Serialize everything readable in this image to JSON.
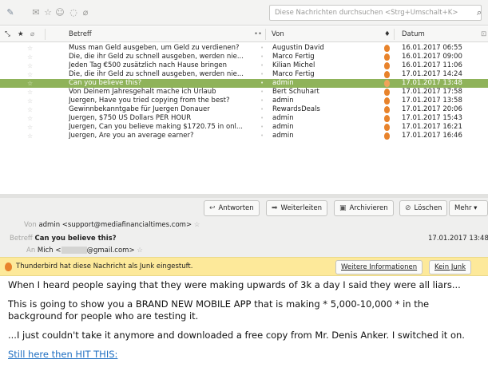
{
  "toolbar": {
    "icons": [
      "pin-icon",
      "unread-icon",
      "star-icon",
      "contact-icon",
      "tag-icon",
      "attachment-icon"
    ],
    "search_placeholder": "Diese Nachrichten durchsuchen <Strg+Umschalt+K>"
  },
  "list_header": {
    "subject": "Betreff",
    "from": "Von",
    "date": "Datum"
  },
  "messages": [
    {
      "subject": "Muss man Geld ausgeben, um Geld zu verdienen?",
      "from": "Augustin David",
      "date": "16.01.2017 06:55"
    },
    {
      "subject": "Die, die ihr Geld zu schnell ausgeben, werden nie...",
      "from": "Marco Fertig",
      "date": "16.01.2017 09:00"
    },
    {
      "subject": "Jeden Tag €500 zusätzlich nach Hause bringen",
      "from": "Kilian Michel",
      "date": "16.01.2017 11:06"
    },
    {
      "subject": "Die, die ihr Geld zu schnell ausgeben, werden nie...",
      "from": "Marco Fertig",
      "date": "17.01.2017 14:24"
    },
    {
      "subject": "Can you believe this?",
      "from": "admin",
      "date": "17.01.2017 13:48"
    },
    {
      "subject": "Von Deinem Jahresgehalt mache ich Urlaub",
      "from": "Bert Schuhart",
      "date": "17.01.2017 17:58"
    },
    {
      "subject": "Juergen, Have you tried copying from the best?",
      "from": "admin",
      "date": "17.01.2017 13:58"
    },
    {
      "subject": "Gewinnbekanntgabe für Juergen Donauer",
      "from": "RewardsDeals",
      "date": "17.01.2017 20:06"
    },
    {
      "subject": "Juergen, $750 US Dollars PER HOUR",
      "from": "admin",
      "date": "17.01.2017 15:43"
    },
    {
      "subject": "Juergen, Can you believe making $1720.75 in onl...",
      "from": "admin",
      "date": "17.01.2017 16:21"
    },
    {
      "subject": "Juergen, Are you an average earner?",
      "from": "admin",
      "date": "17.01.2017 16:46"
    }
  ],
  "selected_index": 4,
  "actions": {
    "reply": "Antworten",
    "forward": "Weiterleiten",
    "archive": "Archivieren",
    "delete": "Löschen",
    "more": "Mehr"
  },
  "header": {
    "from_label": "Von",
    "from_value": "admin <support@mediafinancialtimes.com>",
    "subject_label": "Betreff",
    "subject_value": "Can you believe this?",
    "date_value": "17.01.2017 13:48",
    "to_label": "An",
    "to_value": "Mich <",
    "to_value_suffix": "@gmail.com>"
  },
  "junk": {
    "text": "Thunderbird hat diese Nachricht als Junk eingestuft.",
    "more_info": "Weitere Informationen",
    "not_junk": "Kein Junk"
  },
  "body": {
    "p1": "When I heard people saying that they were making upwards of 3k a day I said they were all liars...",
    "p2": "This is going to show you a BRAND NEW MOBILE APP that is making * 5,000-10,000 * in the background for people who are testing it.",
    "p3": "...I just couldn't take it anymore and downloaded a free copy from Mr. Denis Anker. I switched it on.",
    "link": "Still here then HIT THIS:"
  },
  "colors": {
    "selection": "#8fb35a",
    "junk_bar": "#fde99a",
    "junk_flame": "#e8832b",
    "link": "#1f6fc2"
  }
}
